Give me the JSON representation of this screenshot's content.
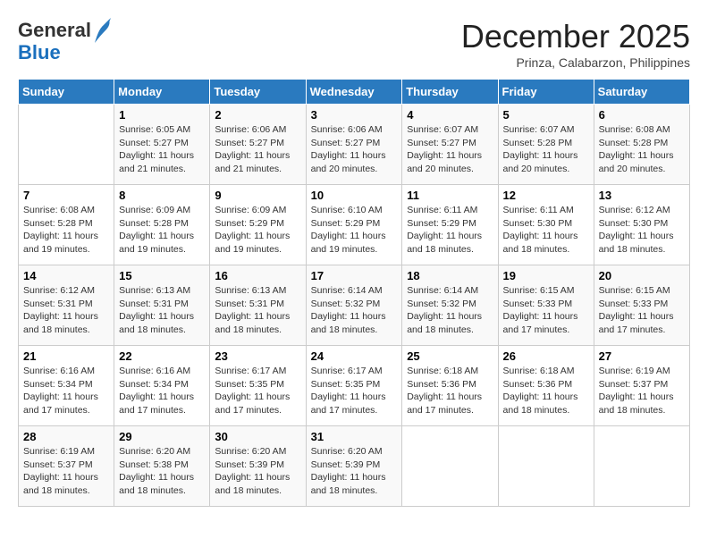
{
  "header": {
    "logo_general": "General",
    "logo_blue": "Blue",
    "title": "December 2025",
    "location": "Prinza, Calabarzon, Philippines"
  },
  "days_of_week": [
    "Sunday",
    "Monday",
    "Tuesday",
    "Wednesday",
    "Thursday",
    "Friday",
    "Saturday"
  ],
  "weeks": [
    [
      {
        "num": "",
        "info": ""
      },
      {
        "num": "1",
        "info": "Sunrise: 6:05 AM\nSunset: 5:27 PM\nDaylight: 11 hours\nand 21 minutes."
      },
      {
        "num": "2",
        "info": "Sunrise: 6:06 AM\nSunset: 5:27 PM\nDaylight: 11 hours\nand 21 minutes."
      },
      {
        "num": "3",
        "info": "Sunrise: 6:06 AM\nSunset: 5:27 PM\nDaylight: 11 hours\nand 20 minutes."
      },
      {
        "num": "4",
        "info": "Sunrise: 6:07 AM\nSunset: 5:27 PM\nDaylight: 11 hours\nand 20 minutes."
      },
      {
        "num": "5",
        "info": "Sunrise: 6:07 AM\nSunset: 5:28 PM\nDaylight: 11 hours\nand 20 minutes."
      },
      {
        "num": "6",
        "info": "Sunrise: 6:08 AM\nSunset: 5:28 PM\nDaylight: 11 hours\nand 20 minutes."
      }
    ],
    [
      {
        "num": "7",
        "info": "Sunrise: 6:08 AM\nSunset: 5:28 PM\nDaylight: 11 hours\nand 19 minutes."
      },
      {
        "num": "8",
        "info": "Sunrise: 6:09 AM\nSunset: 5:28 PM\nDaylight: 11 hours\nand 19 minutes."
      },
      {
        "num": "9",
        "info": "Sunrise: 6:09 AM\nSunset: 5:29 PM\nDaylight: 11 hours\nand 19 minutes."
      },
      {
        "num": "10",
        "info": "Sunrise: 6:10 AM\nSunset: 5:29 PM\nDaylight: 11 hours\nand 19 minutes."
      },
      {
        "num": "11",
        "info": "Sunrise: 6:11 AM\nSunset: 5:29 PM\nDaylight: 11 hours\nand 18 minutes."
      },
      {
        "num": "12",
        "info": "Sunrise: 6:11 AM\nSunset: 5:30 PM\nDaylight: 11 hours\nand 18 minutes."
      },
      {
        "num": "13",
        "info": "Sunrise: 6:12 AM\nSunset: 5:30 PM\nDaylight: 11 hours\nand 18 minutes."
      }
    ],
    [
      {
        "num": "14",
        "info": "Sunrise: 6:12 AM\nSunset: 5:31 PM\nDaylight: 11 hours\nand 18 minutes."
      },
      {
        "num": "15",
        "info": "Sunrise: 6:13 AM\nSunset: 5:31 PM\nDaylight: 11 hours\nand 18 minutes."
      },
      {
        "num": "16",
        "info": "Sunrise: 6:13 AM\nSunset: 5:31 PM\nDaylight: 11 hours\nand 18 minutes."
      },
      {
        "num": "17",
        "info": "Sunrise: 6:14 AM\nSunset: 5:32 PM\nDaylight: 11 hours\nand 18 minutes."
      },
      {
        "num": "18",
        "info": "Sunrise: 6:14 AM\nSunset: 5:32 PM\nDaylight: 11 hours\nand 18 minutes."
      },
      {
        "num": "19",
        "info": "Sunrise: 6:15 AM\nSunset: 5:33 PM\nDaylight: 11 hours\nand 17 minutes."
      },
      {
        "num": "20",
        "info": "Sunrise: 6:15 AM\nSunset: 5:33 PM\nDaylight: 11 hours\nand 17 minutes."
      }
    ],
    [
      {
        "num": "21",
        "info": "Sunrise: 6:16 AM\nSunset: 5:34 PM\nDaylight: 11 hours\nand 17 minutes."
      },
      {
        "num": "22",
        "info": "Sunrise: 6:16 AM\nSunset: 5:34 PM\nDaylight: 11 hours\nand 17 minutes."
      },
      {
        "num": "23",
        "info": "Sunrise: 6:17 AM\nSunset: 5:35 PM\nDaylight: 11 hours\nand 17 minutes."
      },
      {
        "num": "24",
        "info": "Sunrise: 6:17 AM\nSunset: 5:35 PM\nDaylight: 11 hours\nand 17 minutes."
      },
      {
        "num": "25",
        "info": "Sunrise: 6:18 AM\nSunset: 5:36 PM\nDaylight: 11 hours\nand 17 minutes."
      },
      {
        "num": "26",
        "info": "Sunrise: 6:18 AM\nSunset: 5:36 PM\nDaylight: 11 hours\nand 18 minutes."
      },
      {
        "num": "27",
        "info": "Sunrise: 6:19 AM\nSunset: 5:37 PM\nDaylight: 11 hours\nand 18 minutes."
      }
    ],
    [
      {
        "num": "28",
        "info": "Sunrise: 6:19 AM\nSunset: 5:37 PM\nDaylight: 11 hours\nand 18 minutes."
      },
      {
        "num": "29",
        "info": "Sunrise: 6:20 AM\nSunset: 5:38 PM\nDaylight: 11 hours\nand 18 minutes."
      },
      {
        "num": "30",
        "info": "Sunrise: 6:20 AM\nSunset: 5:39 PM\nDaylight: 11 hours\nand 18 minutes."
      },
      {
        "num": "31",
        "info": "Sunrise: 6:20 AM\nSunset: 5:39 PM\nDaylight: 11 hours\nand 18 minutes."
      },
      {
        "num": "",
        "info": ""
      },
      {
        "num": "",
        "info": ""
      },
      {
        "num": "",
        "info": ""
      }
    ]
  ]
}
